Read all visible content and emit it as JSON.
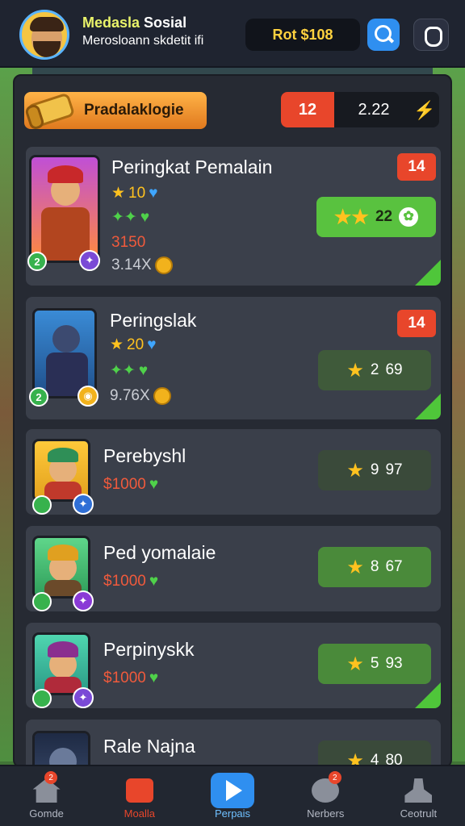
{
  "header": {
    "title_highlight": "Medasla",
    "title_rest": " Sosial",
    "subtitle": "Merosloann skdetit ifi",
    "coins": "Rot $108"
  },
  "panel": {
    "badge_label": "Pradalaklogie",
    "timer_left": "12",
    "timer_right": "2.22"
  },
  "players": [
    {
      "name": "Peringkat Pemalain",
      "rank": "14",
      "level": "2",
      "stars": "10",
      "money": "3150",
      "gold": "3.14X",
      "score_star": "",
      "score": "22",
      "score_extra": ""
    },
    {
      "name": "Peringslak",
      "rank": "14",
      "level": "2",
      "stars": "20",
      "money": "",
      "gold": "9.76X",
      "score_star": "",
      "score": "2",
      "score_extra": "69"
    },
    {
      "name": "Perebyshl",
      "rank": "",
      "level": "",
      "stars": "",
      "money": "$1000",
      "gold": "",
      "score_star": "",
      "score": "9",
      "score_extra": "97"
    },
    {
      "name": "Ped yomalaie",
      "rank": "",
      "level": "",
      "stars": "",
      "money": "$1000",
      "gold": "",
      "score_star": "",
      "score": "8",
      "score_extra": "67"
    },
    {
      "name": "Perpinyskk",
      "rank": "",
      "level": "",
      "stars": "",
      "money": "$1000",
      "gold": "",
      "score_star": "",
      "score": "5",
      "score_extra": "93"
    },
    {
      "name": "Rale Najna",
      "rank": "",
      "level": "",
      "stars": "",
      "money": "",
      "gold": "",
      "score_star": "",
      "score": "4",
      "score_extra": "80"
    }
  ],
  "nav": [
    {
      "label": "Gomde",
      "badge": "2"
    },
    {
      "label": "Moalla",
      "badge": ""
    },
    {
      "label": "Perpais",
      "badge": ""
    },
    {
      "label": "Nerbers",
      "badge": "2"
    },
    {
      "label": "Ceotrult",
      "badge": ""
    }
  ],
  "colors": {
    "accent": "#2f8ff0",
    "rank_red": "#e8462b",
    "score_green": "#59c23f",
    "badge_orange": "#ffb347"
  }
}
